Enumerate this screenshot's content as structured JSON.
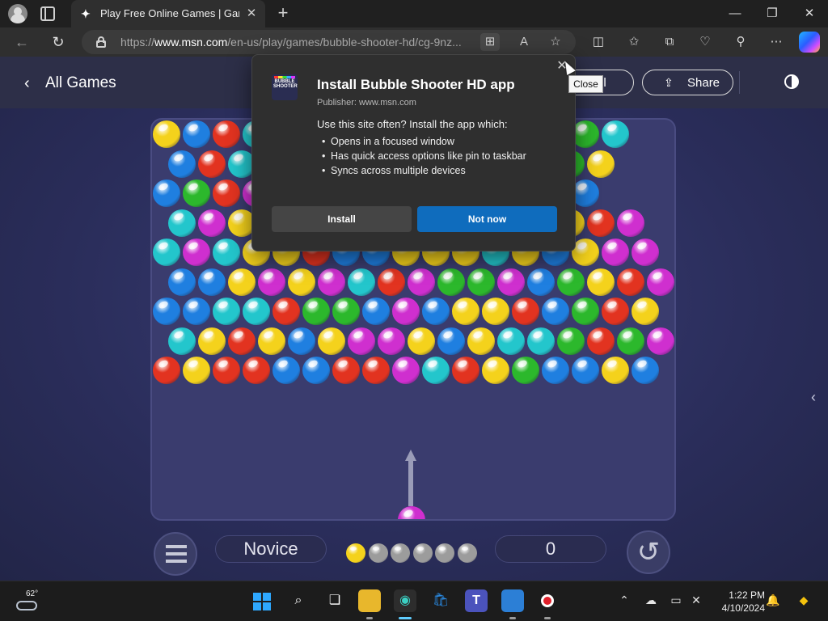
{
  "browser": {
    "tab": {
      "title": "Play Free Online Games | Games",
      "favicon": "msn-games-icon"
    },
    "url_host": "www.msn.com",
    "url_prefix": "https://",
    "url_path": "/en-us/play/games/bubble-shooter-hd/cg-9nz...",
    "icons": [
      "back-icon",
      "refresh-icon",
      "lock-icon",
      "app-available-icon",
      "read-aloud-icon",
      "favorite-star-icon",
      "split-screen-icon",
      "favorites-icon",
      "collections-icon",
      "browser-essentials-icon",
      "extensions-icon",
      "more-icon",
      "copilot-icon"
    ]
  },
  "site": {
    "back_label": "All Games",
    "call_fragment": "ll",
    "share_label": "Share"
  },
  "dialog": {
    "title": "Install Bubble Shooter HD app",
    "publisher": "Publisher: www.msn.com",
    "intro": "Use this site often? Install the app which:",
    "bullets": [
      "Opens in a focused window",
      "Has quick access options like pin to taskbar",
      "Syncs across multiple devices"
    ],
    "install_label": "Install",
    "not_now_label": "Not now",
    "icon_text": "BUBBLE SHOOTER"
  },
  "tooltip": {
    "close": "Close"
  },
  "game": {
    "difficulty": "Novice",
    "score": "0",
    "current_bubble": "magenta",
    "queue": [
      "yellow",
      "gray",
      "gray",
      "gray",
      "gray",
      "gray"
    ],
    "colors": {
      "Y": "#f4d21c",
      "B": "#1f7fe0",
      "R": "#e23320",
      "C": "#23c6cc",
      "G": "#2cb82c",
      "M": "#cf2fcf",
      "gray": "#9c9c9c",
      "magenta": "#cf2fcf",
      "yellow": "#f4d21c"
    },
    "rows": [
      "YBRCBGYRBRCGYBGC",
      "BRCGYBRCGYRBRGY",
      "BGRMYCBRGYBMRYB",
      "CMYRGBCYBCMRGYRM",
      "CMCYYRBBYYYCYBYMM",
      "BBYMYMCRMGGMBGYRM",
      "BBCCRGGBMBYYRBGRY",
      "CYRYBYMMYBYCCGRGM",
      "RYRRBBRRMCRYGBBYB"
    ]
  },
  "taskbar": {
    "temperature": "62°",
    "time": "1:22 PM",
    "date": "4/10/2024",
    "apps": [
      "start-icon",
      "search-icon",
      "task-view-icon",
      "file-explorer-icon",
      "edge-icon",
      "store-icon",
      "teams-icon",
      "photos-icon",
      "recorder-icon"
    ]
  }
}
